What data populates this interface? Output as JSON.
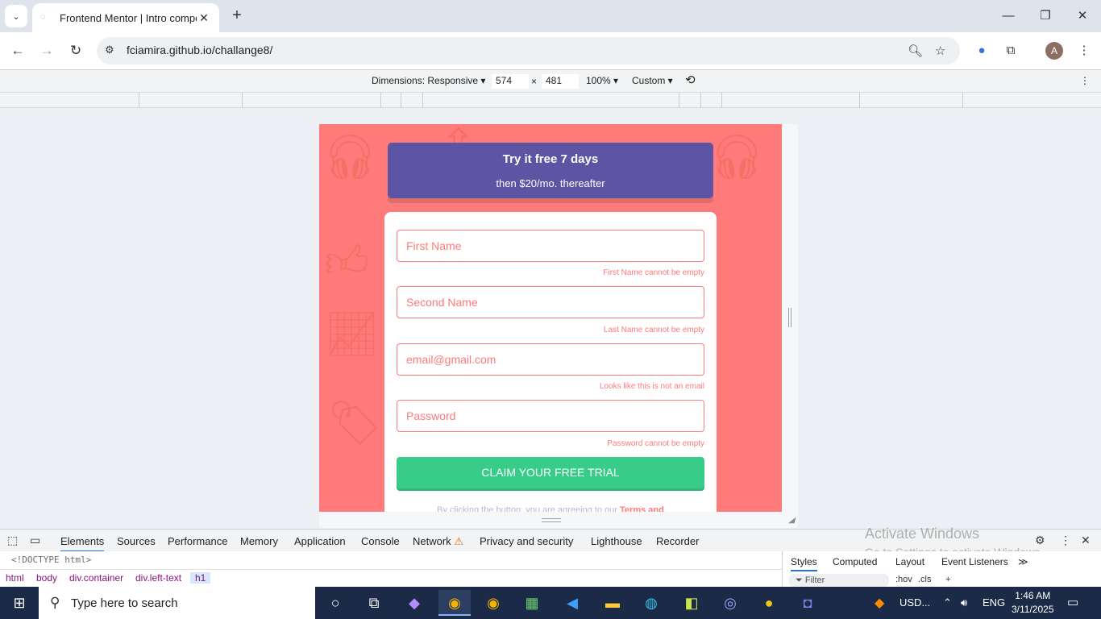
{
  "browser": {
    "tab_title": "Frontend Mentor | Intro compo",
    "url": "fciamira.github.io/challange8/",
    "avatar_initial": "A"
  },
  "device_toolbar": {
    "dimensions_label": "Dimensions: Responsive",
    "width": "574",
    "times": "×",
    "height": "481",
    "zoom": "100%",
    "throttle": "Custom"
  },
  "page": {
    "promo_strong": "Try it free 7 days",
    "promo_sub": "then $20/mo. thereafter",
    "fields": [
      {
        "placeholder": "First Name",
        "error": "First Name cannot be empty"
      },
      {
        "placeholder": "Second Name",
        "error": "Last Name cannot be empty"
      },
      {
        "placeholder": "email@gmail.com",
        "error": "Looks like this is not an email"
      },
      {
        "placeholder": "Password",
        "error": "Password cannot be empty"
      }
    ],
    "claim_button": "CLAIM YOUR FREE TRIAL",
    "terms_text": "By clicking the button, you are agreeing to our ",
    "terms_link": "Terms and"
  },
  "devtools": {
    "tabs": [
      "Elements",
      "Sources",
      "Performance",
      "Memory",
      "Application",
      "Console",
      "Network",
      "Privacy and security",
      "Lighthouse",
      "Recorder"
    ],
    "doctype": "<!DOCTYPE html>",
    "breadcrumbs": [
      "html",
      "body",
      "div.container",
      "div.left-text",
      "h1"
    ],
    "styles_tabs": [
      "Styles",
      "Computed",
      "Layout",
      "Event Listeners"
    ],
    "filter_placeholder": "Filter",
    "hov": ":hov",
    "cls": ".cls"
  },
  "watermark": {
    "line1": "Activate Windows",
    "line2": "Go to Settings to activate Windows."
  },
  "taskbar": {
    "search_placeholder": "Type here to search",
    "tray_currency": "USD...",
    "language": "ENG",
    "time": "1:46 AM",
    "date": "3/11/2025"
  },
  "colors": {
    "accent_red": "#ff7a7a",
    "promo_purple": "#5e54a4",
    "claim_green": "#38cc8b"
  }
}
